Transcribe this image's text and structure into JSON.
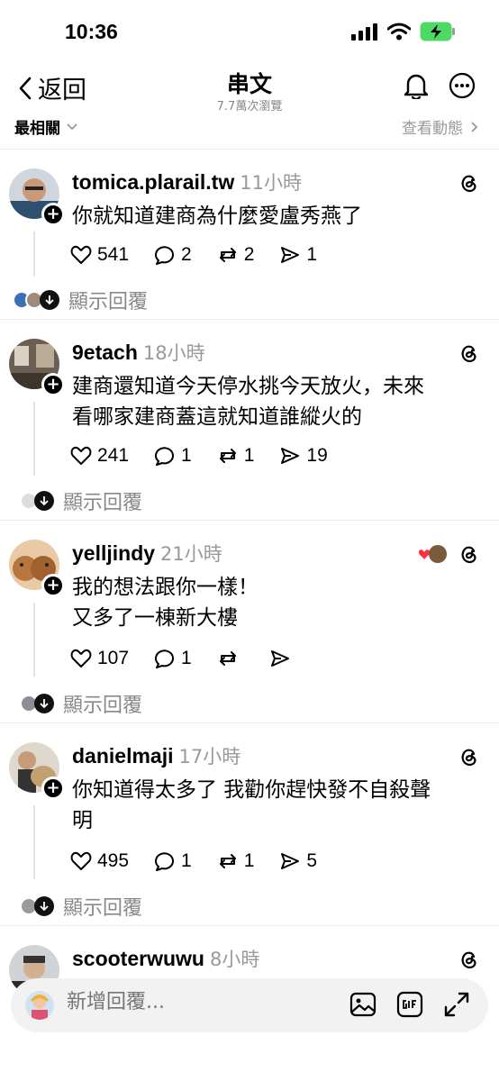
{
  "status": {
    "time": "10:36"
  },
  "nav": {
    "back_label": "返回",
    "title": "串文",
    "subtitle": "7.7萬次瀏覽"
  },
  "sort": {
    "left_label": "最相關",
    "right_label": "查看動態"
  },
  "posts": [
    {
      "username": "tomica.plarail.tw",
      "time": "11小時",
      "lines": [
        "你就知道建商為什麼愛盧秀燕了"
      ],
      "likes": "541",
      "comments": "2",
      "reposts": "2",
      "shares": "1",
      "replies_label": "顯示回覆"
    },
    {
      "username": "9etach",
      "time": "18小時",
      "lines": [
        "建商還知道今天停水挑今天放火，未來",
        "看哪家建商蓋這就知道誰縱火的"
      ],
      "likes": "241",
      "comments": "1",
      "reposts": "1",
      "shares": "19",
      "replies_label": "顯示回覆"
    },
    {
      "username": "yelljindy",
      "time": "21小時",
      "lines": [
        "我的想法跟你一樣！",
        "又多了一棟新大樓"
      ],
      "likes": "107",
      "comments": "1",
      "reposts": "",
      "shares": "",
      "replies_label": "顯示回覆"
    },
    {
      "username": "danielmaji",
      "time": "17小時",
      "lines": [
        "你知道得太多了 我勸你趕快發不自殺聲",
        "明"
      ],
      "likes": "495",
      "comments": "1",
      "reposts": "1",
      "shares": "5",
      "replies_label": "顯示回覆"
    },
    {
      "username": "scooterwuwu",
      "time": "8小時"
    }
  ],
  "composer": {
    "placeholder": "新增回覆..."
  },
  "colors": {
    "heart_red": "#ff3040",
    "divider": "#ececec",
    "muted": "#999999"
  }
}
